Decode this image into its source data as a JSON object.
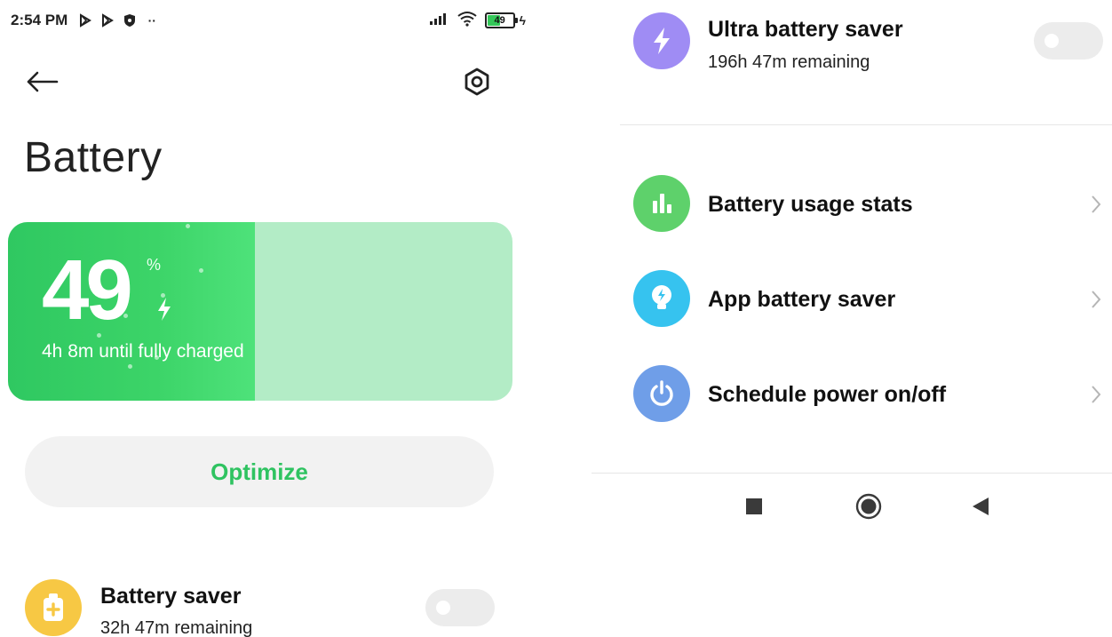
{
  "status_bar": {
    "time": "2:54 PM",
    "icons": [
      "play-store-icon",
      "play-store-icon",
      "shield-icon",
      "more-dots-icon"
    ],
    "more": "··",
    "battery_level": "49"
  },
  "header": {
    "title": "Battery",
    "back_icon": "arrow-left-icon",
    "settings_icon": "hexagon-settings-icon"
  },
  "battery_card": {
    "percent": "49",
    "percent_sign": "%",
    "charge_fraction": 0.49,
    "status_text": "4h 8m until fully charged"
  },
  "optimize": {
    "label": "Optimize"
  },
  "battery_saver": {
    "title": "Battery saver",
    "subtitle": "32h 47m remaining",
    "enabled": false
  },
  "ultra_battery_saver": {
    "title": "Ultra battery saver",
    "subtitle": "196h 47m remaining",
    "enabled": false
  },
  "menu": [
    {
      "label": "Battery usage stats",
      "icon": "bar-chart-icon",
      "color": "#5ed16b"
    },
    {
      "label": "App battery saver",
      "icon": "lightbulb-icon",
      "color": "#36c3ef"
    },
    {
      "label": "Schedule power on/off",
      "icon": "power-icon",
      "color": "#6f9ee8"
    }
  ],
  "colors": {
    "green_accent": "#2fc361",
    "battery_saver_icon": "#f7c844",
    "ultra_saver_icon": "#9f8cf4"
  },
  "nav": [
    "recents-square-icon",
    "home-circle-icon",
    "back-triangle-icon"
  ]
}
